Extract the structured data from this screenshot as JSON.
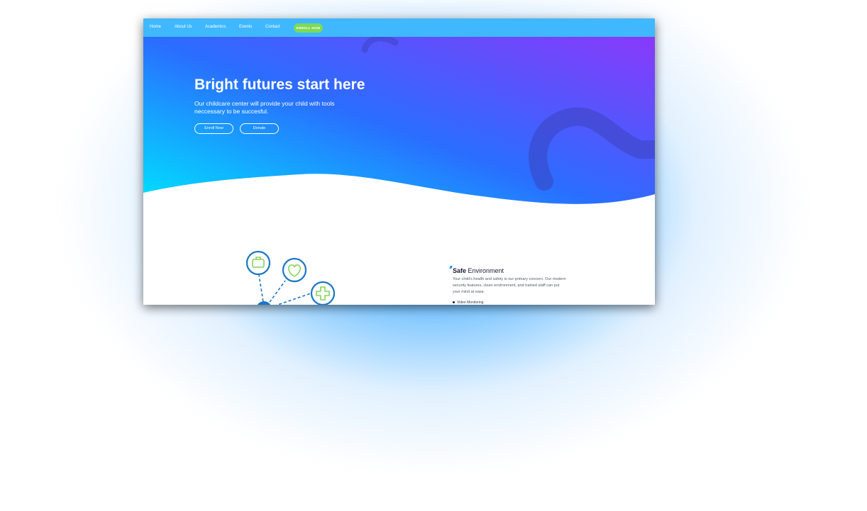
{
  "nav": {
    "items": [
      "Home",
      "About Us",
      "Academics",
      "Events",
      "Contact"
    ],
    "cta_label": "ENROLL NOW"
  },
  "hero": {
    "title": "Bright futures start here",
    "subtitle": "Our childcare center will provide your child with tools neccessary to be succesful.",
    "buttons": [
      "Enroll Now",
      "Donate"
    ]
  },
  "feature": {
    "title_bold": "Safe",
    "title_rest": " Environment",
    "description": "Your child's health and safety is our primary concern. Our modern security features, clean environment, and trained staff can put your mind at ease.",
    "list_item": "Video Monitoring",
    "icons": [
      "briefcase-icon",
      "heart-chat-icon",
      "plus-icon"
    ]
  },
  "colors": {
    "nav_bg": "#3fb8ff",
    "cta_green": "#7ed957",
    "hero_cyan": "#00e1ff",
    "hero_blue": "#2a6dff",
    "hero_violet": "#9334fa",
    "icon_blue": "#1c75c8",
    "icon_green": "#86d35a",
    "glow_blue": "#288cff"
  }
}
